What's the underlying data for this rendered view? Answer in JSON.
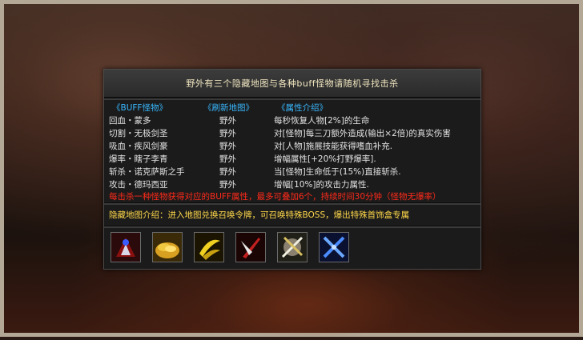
{
  "header": {
    "title": "野外有三个隐藏地图与各种buff怪物请随机寻找击杀"
  },
  "columns": [
    "《BUFF怪物》",
    "《刷新地图》",
    "《属性介绍》"
  ],
  "rows": [
    {
      "name": "回血・蒙多",
      "map": "野外",
      "desc": "每秒恢复人物[2%]的生命"
    },
    {
      "name": "切割・无极剑圣",
      "map": "野外",
      "desc": "对[怪物]每三刀额外造成(输出×2倍)的真实伤害"
    },
    {
      "name": "吸血・疾风剑豪",
      "map": "野外",
      "desc": "对[人物]施展技能获得嗜血补充."
    },
    {
      "name": "爆率・瞎子李青",
      "map": "野外",
      "desc": "增幅属性[+20%打野爆率]."
    },
    {
      "name": "斩杀・诺克萨斯之手",
      "map": "野外",
      "desc": "当[怪物]生命低于(15%)直接斩杀."
    },
    {
      "name": "攻击・德玛西亚",
      "map": "野外",
      "desc": "增幅[10%]的攻击力属性."
    }
  ],
  "note_red": "每击杀一种怪物获得对应的BUFF属性，最多可叠加6个，持续时间30分钟（怪物无爆率）",
  "note_yellow": "隐藏地图介绍：进入地图兑换召唤令牌，可召唤特殊BOSS，爆出特殊首饰盒专属",
  "icons": [
    "blood-warrior-icon",
    "gold-pile-icon",
    "golden-slash-icon",
    "red-blade-icon",
    "crossed-sword-shield-icon",
    "blue-crossed-swords-icon"
  ],
  "colors": {
    "column_header": "#38b8ff",
    "note_red": "#ff2a1a",
    "note_yellow": "#ffd84a",
    "title": "#f0e6c0"
  }
}
